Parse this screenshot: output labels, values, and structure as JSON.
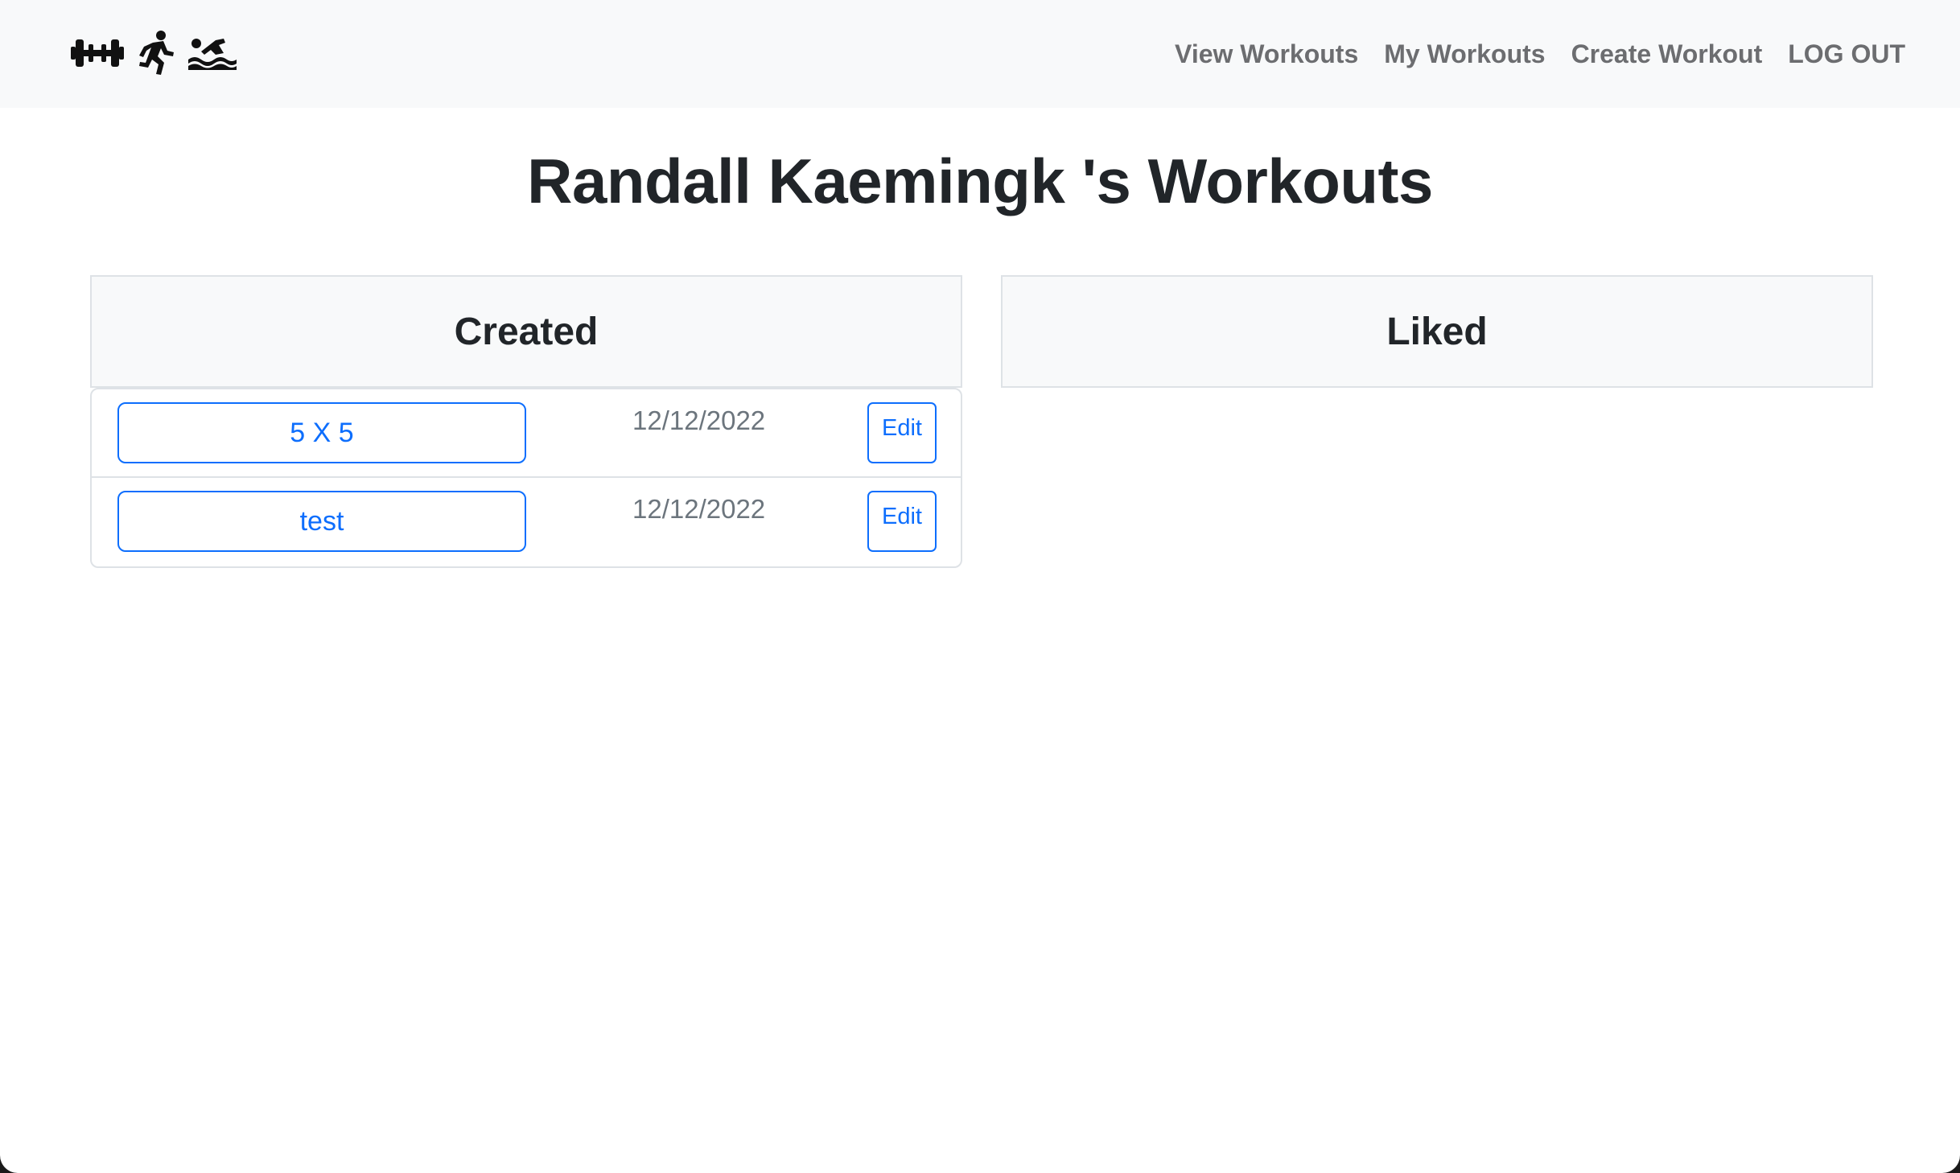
{
  "navbar": {
    "brand_icons": [
      "dumbbell-icon",
      "running-icon",
      "swimming-icon"
    ],
    "links": [
      {
        "label": "View Workouts"
      },
      {
        "label": "My Workouts"
      },
      {
        "label": "Create Workout"
      },
      {
        "label": "LOG OUT"
      }
    ]
  },
  "page": {
    "title": "Randall Kaemingk 's Workouts"
  },
  "created": {
    "header": "Created",
    "items": [
      {
        "name": "5 X 5",
        "date": "12/12/2022",
        "edit_label": "Edit"
      },
      {
        "name": "test",
        "date": "12/12/2022",
        "edit_label": "Edit"
      }
    ]
  },
  "liked": {
    "header": "Liked",
    "items": []
  },
  "colors": {
    "primary": "#0d6efd",
    "navbar_bg": "#f8f9fa",
    "heading": "#212529",
    "muted": "#6c757d",
    "nav_link": "#6c6d70"
  }
}
